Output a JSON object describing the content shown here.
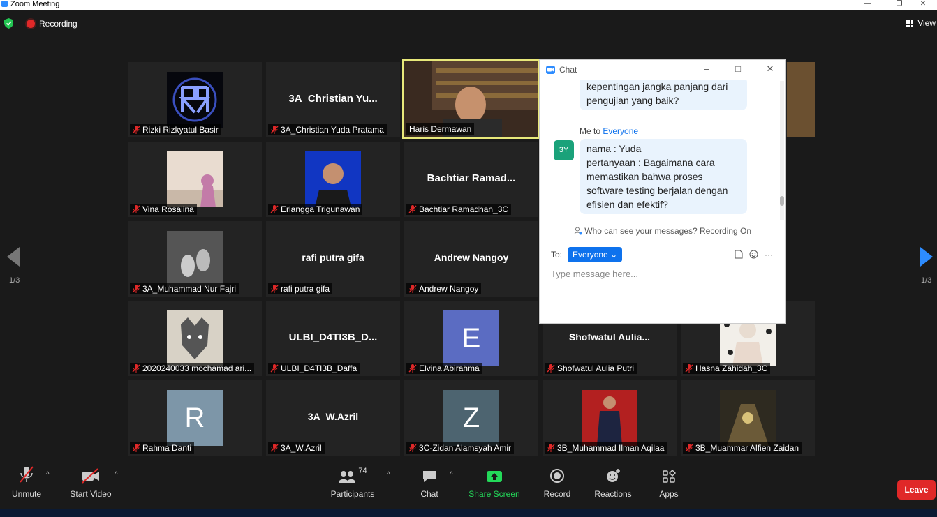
{
  "window": {
    "title": "Zoom Meeting"
  },
  "status": {
    "recording_label": "Recording",
    "view_label": "View"
  },
  "pager": {
    "left": "1/3",
    "right": "1/3"
  },
  "tiles": [
    {
      "display": "",
      "label": "Rizki Rizkyatul Basir"
    },
    {
      "display": "3A_Christian Yu...",
      "label": "3A_Christian Yuda Pratama"
    },
    {
      "display": "",
      "label": "Haris Dermawan"
    },
    {
      "display": "",
      "label": "Vina Rosalina"
    },
    {
      "display": "",
      "label": "Erlangga Trigunawan"
    },
    {
      "display": "Bachtiar Ramad...",
      "label": "Bachtiar Ramadhan_3C"
    },
    {
      "display": "",
      "label": "3A_Muhammad Nur Fajri"
    },
    {
      "display": "rafi putra gifa",
      "label": "rafi putra gifa"
    },
    {
      "display": "Andrew Nangoy",
      "label": "Andrew Nangoy"
    },
    {
      "display": "",
      "label": "2020240033 mochamad ari..."
    },
    {
      "display": "ULBI_D4TI3B_D...",
      "label": "ULBI_D4TI3B_Daffa"
    },
    {
      "display": "E",
      "label": "Elvina Abirahma"
    },
    {
      "display": "Shofwatul Aulia...",
      "label": "Shofwatul Aulia Putri"
    },
    {
      "display": "",
      "label": "Hasna Zahidah_3C"
    },
    {
      "display": "R",
      "label": "Rahma Danti"
    },
    {
      "display": "3A_W.Azril",
      "label": "3A_W.Azril"
    },
    {
      "display": "Z",
      "label": "3C-Zidan Alamsyah Amir"
    },
    {
      "display": "",
      "label": "3B_Muhammad Ilman Aqilaa"
    },
    {
      "display": "",
      "label": "3B_Muammar Alfien Zaidan"
    }
  ],
  "chat": {
    "title": "Chat",
    "prev_message": "kepentingan jangka panjang dari pengujian yang baik?",
    "sender_prefix": "Me to",
    "sender_to": "Everyone",
    "avatar_initials": "3Y",
    "message_line1": "nama : Yuda",
    "message_line2": "pertanyaan : Bagaimana cara memastikan bahwa proses software testing berjalan dengan efisien dan efektif?",
    "privacy_note": "Who can see your messages? Recording On",
    "to_label": "To:",
    "to_value": "Everyone",
    "input_placeholder": "Type message here..."
  },
  "toolbar": {
    "unmute": "Unmute",
    "start_video": "Start Video",
    "participants": "Participants",
    "participants_count": "74",
    "chat": "Chat",
    "share_screen": "Share Screen",
    "record": "Record",
    "reactions": "Reactions",
    "apps": "Apps",
    "leave": "Leave"
  },
  "colors": {
    "accent": "#0e72ed",
    "share": "#23d959",
    "leave": "#e02828",
    "speaker_border": "#e8e87a"
  }
}
